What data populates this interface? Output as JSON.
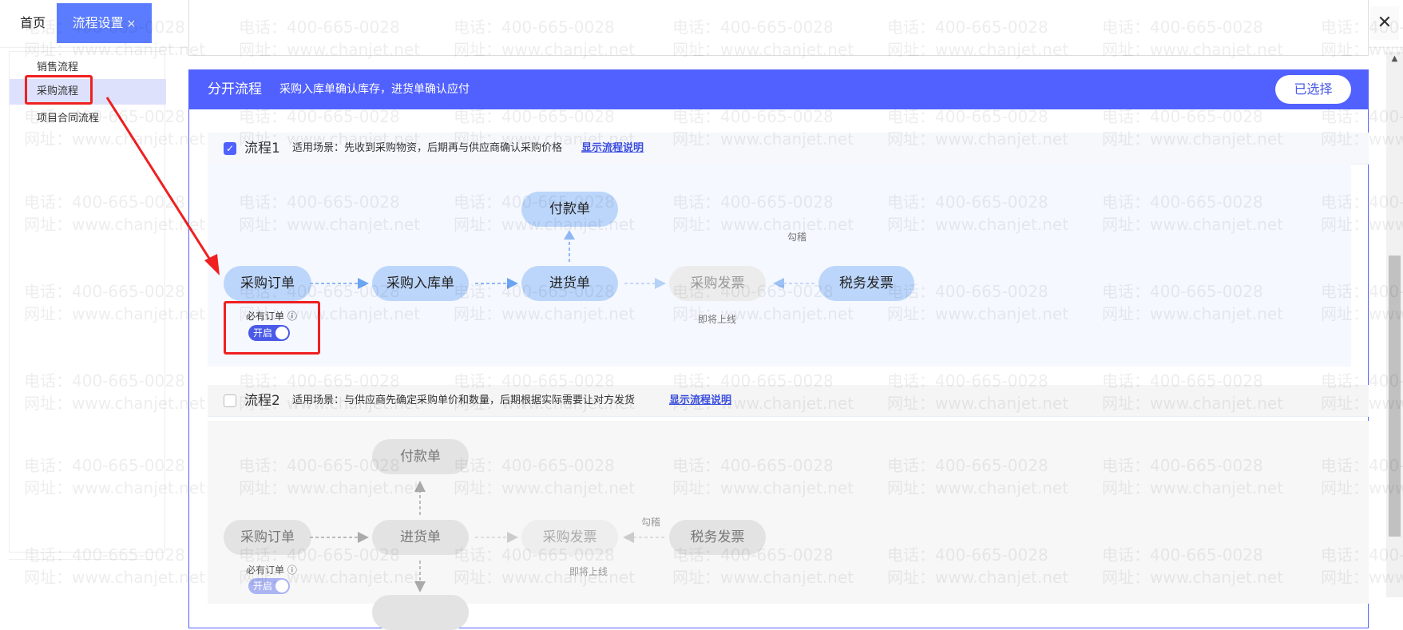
{
  "tabs": {
    "home": "首页",
    "active": "流程设置",
    "close": "×"
  },
  "window_close": "✕",
  "sidebar": {
    "items": [
      {
        "label": "销售流程"
      },
      {
        "label": "采购流程",
        "selected": true
      },
      {
        "label": "项目合同流程"
      }
    ]
  },
  "panel": {
    "title": "分开流程",
    "desc": "采购入库单确认库存，进货单确认应付",
    "button": "已选择"
  },
  "flow1": {
    "checked": true,
    "name": "流程1",
    "desc": "适用场景：先收到采购物资，后期再与供应商确认采购价格",
    "link": "显示流程说明",
    "nodes": {
      "order": "采购订单",
      "inbound": "采购入库单",
      "receipt": "进货单",
      "payment": "付款单",
      "invoice": "采购发票",
      "tax": "税务发票"
    },
    "match": "勾稽",
    "soon": "即将上线",
    "must_order": "必有订单",
    "toggle": "开启",
    "toggle_on": true
  },
  "flow2": {
    "checked": false,
    "name": "流程2",
    "desc": "适用场景：与供应商先确定采购单价和数量，后期根据实际需要让对方发货",
    "link": "显示流程说明",
    "nodes": {
      "order": "采购订单",
      "receipt": "进货单",
      "payment": "付款单",
      "invoice": "采购发票",
      "tax": "税务发票"
    },
    "match": "勾稽",
    "soon": "即将上线",
    "must_order": "必有订单",
    "toggle": "开启",
    "toggle_on": true
  },
  "watermark": {
    "phone": "电话：400-665-0028",
    "site": "网址：www.chanjet.net"
  },
  "colors": {
    "accent": "#5161ff",
    "tab_active": "#5b7cff",
    "node": "#bcd6fb",
    "highlight": "#f02020"
  }
}
